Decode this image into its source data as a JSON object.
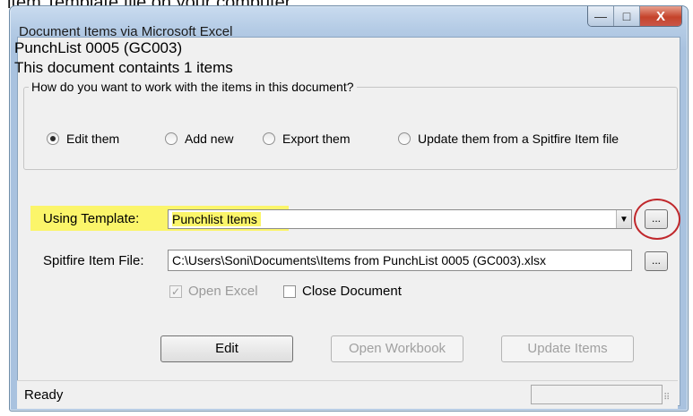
{
  "background_text": "item Template file on your computer.",
  "window": {
    "title": "Document Items via Microsoft Excel",
    "minimize_glyph": "—",
    "maximize_glyph": "□",
    "close_glyph": "X"
  },
  "document": {
    "name": "PunchList 0005 (GC003)",
    "count_text": "This document containts 1 items"
  },
  "mode_group": {
    "legend": "How do you want to work with the items in this document?",
    "options": [
      {
        "label": "Edit them",
        "selected": true
      },
      {
        "label": "Add new",
        "selected": false
      },
      {
        "label": "Export them",
        "selected": false
      },
      {
        "label": "Update them from a Spitfire Item file",
        "selected": false
      }
    ]
  },
  "template": {
    "label": "Using Template:",
    "value": "Punchlist Items",
    "browse_label": "..."
  },
  "item_file": {
    "label": "Spitfire Item File:",
    "value": "C:\\Users\\Soni\\Documents\\Items from PunchList 0005 (GC003).xlsx",
    "browse_label": "..."
  },
  "options": {
    "open_excel": {
      "label": "Open Excel",
      "checked": true,
      "enabled": false
    },
    "close_document": {
      "label": "Close Document",
      "checked": false,
      "enabled": true
    }
  },
  "buttons": {
    "edit": "Edit",
    "open_workbook": "Open Workbook",
    "update_items": "Update Items"
  },
  "status": {
    "text": "Ready"
  },
  "colors": {
    "highlight": "#fbf56a",
    "annotation_ring": "#c0282c"
  }
}
